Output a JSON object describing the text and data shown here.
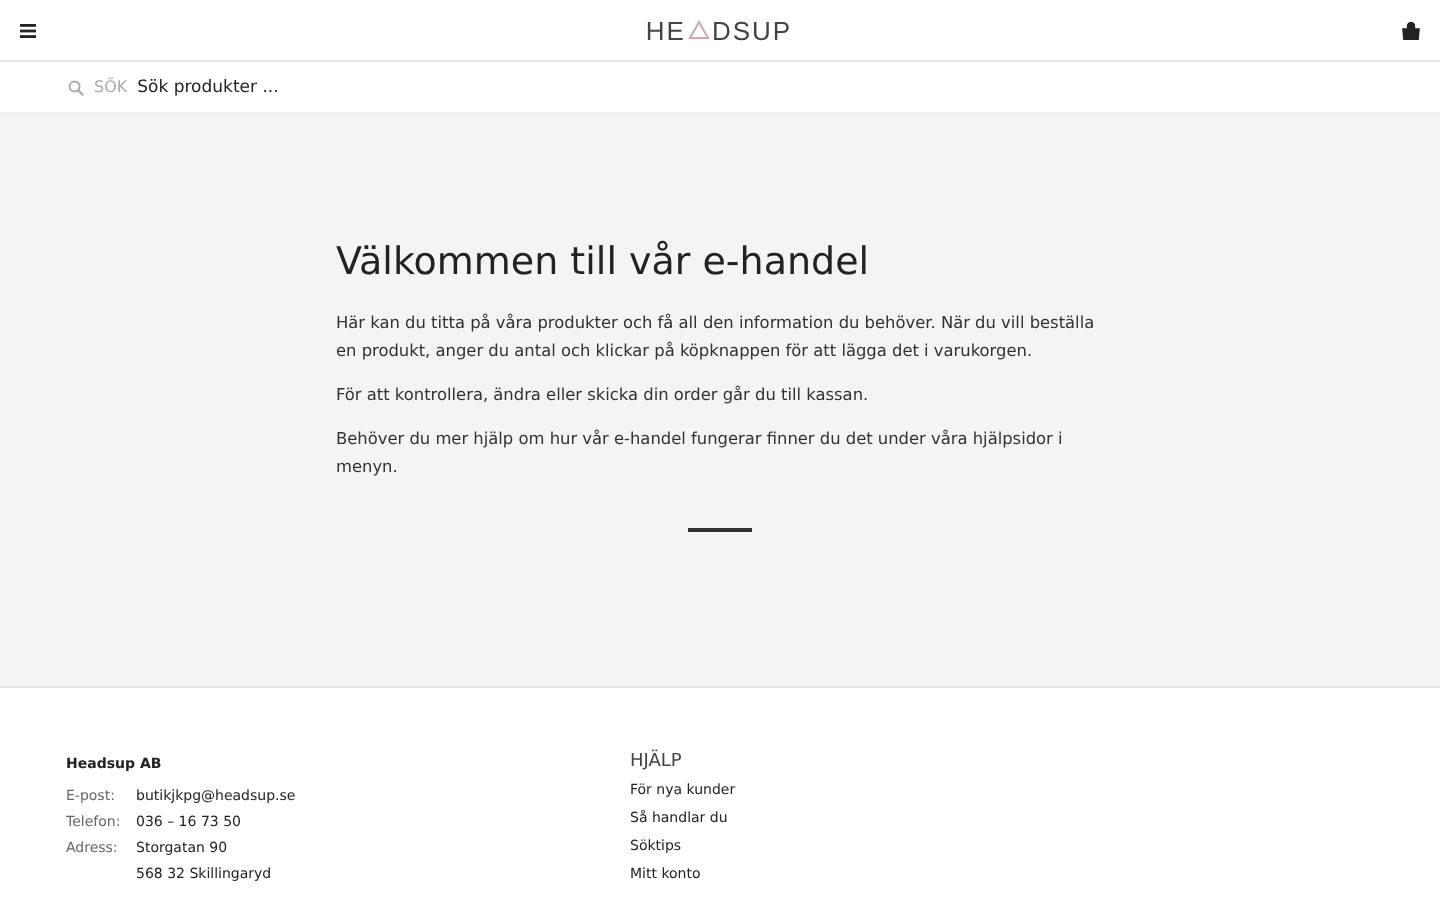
{
  "header": {
    "logo": {
      "before": "HE",
      "after": "DSUP"
    }
  },
  "search": {
    "label": "SÖK",
    "placeholder": "Sök produkter ..."
  },
  "hero": {
    "title": "Välkommen till vår e-handel",
    "paragraphs": [
      "Här kan du titta på våra produkter och få all den information du behöver. När du vill beställa en produkt, anger du antal och klickar på köpknappen för att lägga det i varukorgen.",
      "För att kontrollera, ändra eller skicka din order går du till kassan.",
      "Behöver du mer hjälp om hur vår e-handel fungerar finner du det under våra hjälpsidor i menyn."
    ]
  },
  "footer": {
    "company": "Headsup AB",
    "contact": [
      {
        "label": "E-post:",
        "lines": [
          "butikjkpg@headsup.se"
        ]
      },
      {
        "label": "Telefon:",
        "lines": [
          "036 – 16 73 50"
        ]
      },
      {
        "label": "Adress:",
        "lines": [
          "Storgatan 90",
          "568 32 Skillingaryd"
        ]
      }
    ],
    "help": {
      "title": "HJÄLP",
      "links": [
        "För nya kunder",
        "Så handlar du",
        "Söktips",
        "Mitt konto"
      ]
    }
  }
}
